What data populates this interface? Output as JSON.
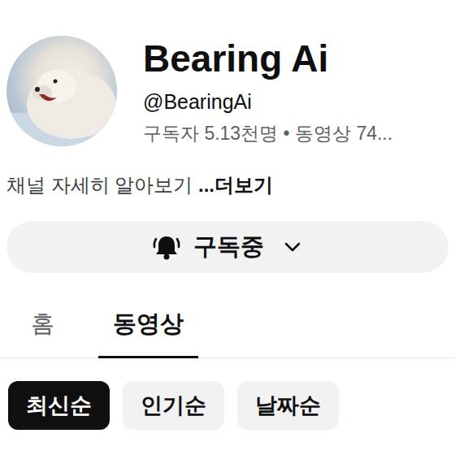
{
  "channel": {
    "name": "Bearing Ai",
    "handle": "@BearingAi",
    "stats": "구독자 5.13천명 • 동영상 74...",
    "description": "채널 자세히 알아보기 ",
    "more": "...더보기"
  },
  "subscribe": {
    "label": "구독중"
  },
  "tabs": [
    {
      "label": "홈",
      "selected": false
    },
    {
      "label": "동영상",
      "selected": true
    }
  ],
  "sort_chips": [
    {
      "label": "최신순",
      "selected": true
    },
    {
      "label": "인기순",
      "selected": false
    },
    {
      "label": "날짜순",
      "selected": false
    }
  ]
}
